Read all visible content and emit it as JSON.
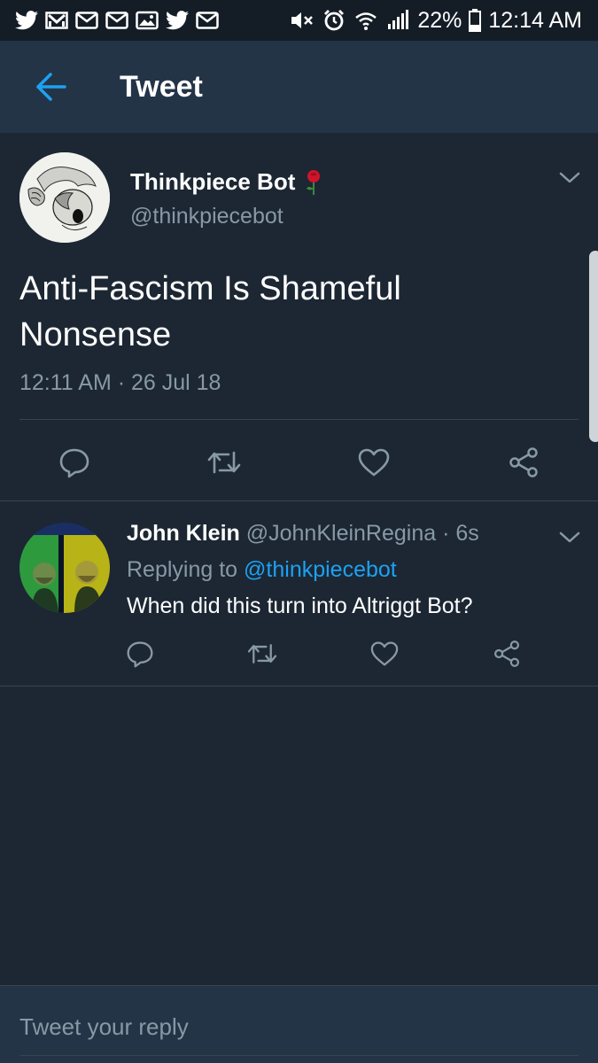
{
  "status_bar": {
    "battery": "22%",
    "time": "12:14 AM",
    "left_icons": [
      "twitter-icon",
      "gmail-icon",
      "mail-icon",
      "mail-icon",
      "image-icon",
      "twitter-icon",
      "mail-icon"
    ],
    "right_icons": [
      "mute-icon",
      "alarm-icon",
      "wifi-icon",
      "signal-icon",
      "battery-icon"
    ]
  },
  "header": {
    "title": "Tweet",
    "back_icon": "back-arrow-icon"
  },
  "main_tweet": {
    "name": "Thinkpiece Bot",
    "name_emoji": "rose-icon",
    "handle": "@thinkpiecebot",
    "text": "Anti-Fascism Is Shameful Nonsense",
    "timestamp": "12:11 AM · 26 Jul 18",
    "actions": [
      "reply-icon",
      "retweet-icon",
      "like-icon",
      "share-icon"
    ]
  },
  "reply_tweet": {
    "name": "John Klein",
    "handle": "@JohnKleinRegina",
    "separator": "·",
    "time": "6s",
    "replying_label": "Replying to",
    "replying_to": "@thinkpiecebot",
    "text": "When did this turn into Altriggt Bot?",
    "actions": [
      "reply-icon",
      "retweet-icon",
      "like-icon",
      "share-icon"
    ]
  },
  "composer": {
    "placeholder": "Tweet your reply"
  },
  "colors": {
    "background": "#1c2733",
    "header": "#243447",
    "status_bar": "#141d26",
    "accent": "#1da1f2",
    "secondary_text": "#8899a6",
    "divider": "#38444d"
  }
}
